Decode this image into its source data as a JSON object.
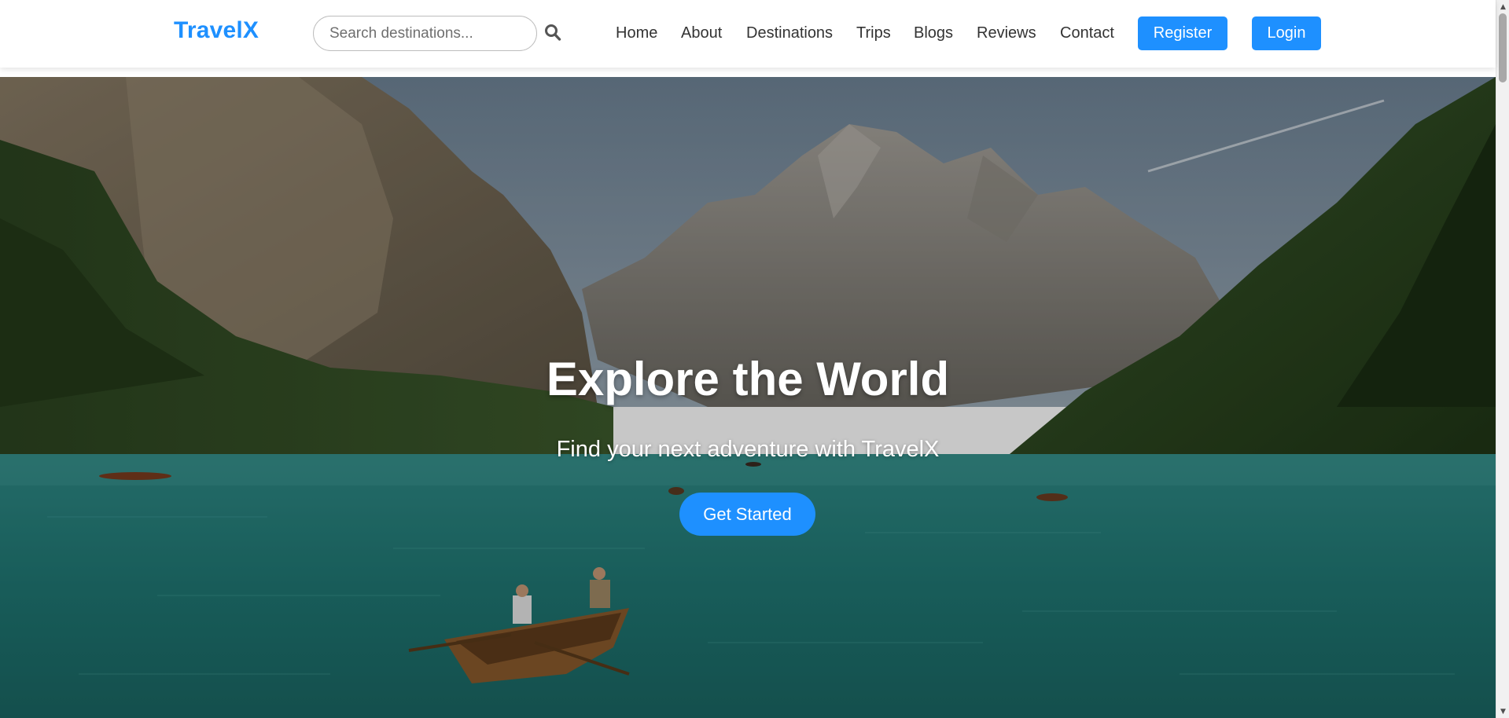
{
  "brand": {
    "logo": "TravelX",
    "accent_color": "#1e90ff"
  },
  "search": {
    "placeholder": "Search destinations...",
    "value": "",
    "icon": "search-icon"
  },
  "nav": {
    "links": [
      {
        "label": "Home"
      },
      {
        "label": "About"
      },
      {
        "label": "Destinations"
      },
      {
        "label": "Trips"
      },
      {
        "label": "Blogs"
      },
      {
        "label": "Reviews"
      },
      {
        "label": "Contact"
      }
    ],
    "register_label": "Register",
    "login_label": "Login"
  },
  "hero": {
    "title": "Explore the World",
    "subtitle": "Find your next adventure with TravelX",
    "cta_label": "Get Started",
    "image": "mountain-lake-boats-photo"
  }
}
